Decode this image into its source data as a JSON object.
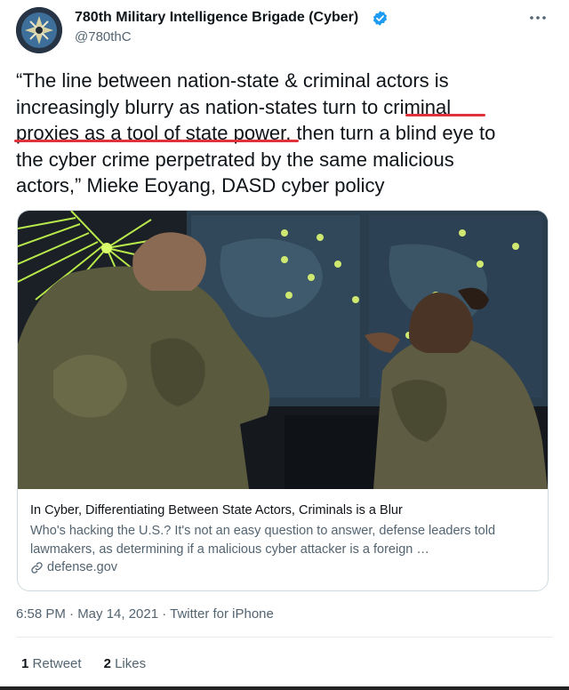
{
  "account": {
    "name": "780th Military Intelligence Brigade (Cyber)",
    "handle": "@780thC",
    "verified": true,
    "avatar_icon": "brigade-insignia-icon"
  },
  "more_icon": "more-options-icon",
  "tweet": {
    "lines": [
      "“The line between nation-state & criminal actors is",
      "increasingly blurry as nation-states turn to criminal",
      "proxies as a tool of state power, then turn a blind eye to",
      "the cyber crime perpetrated by the same malicious",
      "actors,” Mieke Eoyang, DASD cyber policy"
    ],
    "underline_color": "#e0323c"
  },
  "card": {
    "image_alt": "Two service members in camouflage viewing a large cyber operations map display",
    "title": "In Cyber, Differentiating Between State Actors, Criminals is a Blur",
    "description": "Who's hacking the U.S.? It's not an easy question to answer, defense leaders told lawmakers, as determining if a malicious cyber attacker is a foreign …",
    "domain": "defense.gov",
    "domain_icon": "link-icon"
  },
  "meta": {
    "timestamp": "6:58 PM · May 14, 2021 · Twitter for iPhone"
  },
  "stats": {
    "retweets_count": "1",
    "retweets_label": "Retweet",
    "likes_count": "2",
    "likes_label": "Likes"
  },
  "colors": {
    "verified_blue": "#1d9bf0",
    "secondary_text": "#536471"
  }
}
